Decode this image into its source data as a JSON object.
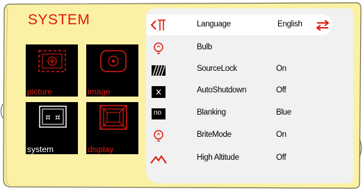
{
  "colors": {
    "frame": "#fbf1a4",
    "frame_border": "#6f6c4e",
    "accent": "#e01b10",
    "panel": "#f1f1f1",
    "selected": "#ffffff"
  },
  "title": "SYSTEM",
  "tiles": [
    {
      "caption": "picture",
      "icon": "picture-tile-icon",
      "selected": false
    },
    {
      "caption": "image",
      "icon": "image-tile-icon",
      "selected": false
    },
    {
      "caption": "system",
      "icon": "system-tile-icon",
      "selected": true
    },
    {
      "caption": "display",
      "icon": "display-tile-icon",
      "selected": false
    }
  ],
  "menu": {
    "items": [
      {
        "label": "Language",
        "value": "English",
        "icon": "language-icon",
        "selected": true,
        "arrows": "swap-arrows-icon"
      },
      {
        "label": "Bulb",
        "value": "",
        "icon": "bulb-icon"
      },
      {
        "label": "SourceLock",
        "value": "On",
        "icon": "source-lock-icon"
      },
      {
        "label": "AutoShutdown",
        "value": "Off",
        "icon": "auto-shutdown-icon"
      },
      {
        "label": "Blanking",
        "value": "Blue",
        "icon": "blanking-icon",
        "icon_text": "no"
      },
      {
        "label": "BriteMode",
        "value": "On",
        "icon": "brite-mode-icon"
      },
      {
        "label": "High Altitude",
        "value": "Off",
        "icon": "high-altitude-icon"
      }
    ]
  }
}
